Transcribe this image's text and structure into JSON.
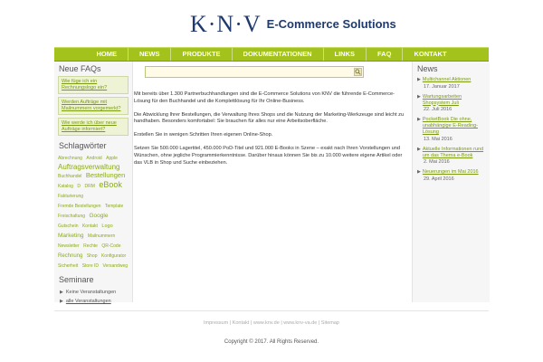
{
  "header": {
    "logo_mark": "K·N·V",
    "logo_text": "E-Commerce Solutions"
  },
  "nav": [
    "HOME",
    "NEWS",
    "PRODUKTE",
    "DOKUMENTATIONEN",
    "LINKS",
    "FAQ",
    "KONTAKT"
  ],
  "sidebar_left": {
    "faq_title": "Neue FAQs",
    "faqs": [
      "Wie füge ich ein Rechnungslogo ein?",
      "Werden Aufträge mit Mailnummern vorgemerkt?",
      "Wie werde ich über neue Aufträge informiert?"
    ],
    "tags_title": "Schlagwörter",
    "tags": [
      {
        "label": "Abrechnung",
        "size": 5
      },
      {
        "label": "Android",
        "size": 5
      },
      {
        "label": "Apple",
        "size": 5
      },
      {
        "label": "Auftragsverwaltung",
        "size": 8
      },
      {
        "label": "Buchhandel",
        "size": 5
      },
      {
        "label": "Bestellungen",
        "size": 7.5
      },
      {
        "label": "Katalog",
        "size": 5
      },
      {
        "label": "D",
        "size": 5
      },
      {
        "label": "DRM",
        "size": 5
      },
      {
        "label": "eBook",
        "size": 9
      },
      {
        "label": "Fakturierung",
        "size": 5
      },
      {
        "label": "Fremde Bestellungen",
        "size": 5
      },
      {
        "label": "Template",
        "size": 5
      },
      {
        "label": "Freischaltung",
        "size": 5
      },
      {
        "label": "Google",
        "size": 6.5
      },
      {
        "label": "Gutschein",
        "size": 5
      },
      {
        "label": "Kontakt",
        "size": 5
      },
      {
        "label": "Logo",
        "size": 5.5
      },
      {
        "label": "Marketing",
        "size": 6.5
      },
      {
        "label": "Mailnummern",
        "size": 5
      },
      {
        "label": "Newsletter",
        "size": 5
      },
      {
        "label": "Rechte",
        "size": 5
      },
      {
        "label": "QR-Code",
        "size": 5
      },
      {
        "label": "Rechnung",
        "size": 6
      },
      {
        "label": "Shop",
        "size": 5
      },
      {
        "label": "Konfigurator",
        "size": 5
      },
      {
        "label": "Sicherheit",
        "size": 5
      },
      {
        "label": "Store ID",
        "size": 5
      },
      {
        "label": "Versandweg",
        "size": 5
      }
    ],
    "seminar_title": "Seminare",
    "seminars": [
      {
        "label": "Keine Veranstaltungen",
        "linked": false
      },
      {
        "label": "alle Veranstaltungen",
        "linked": true
      }
    ]
  },
  "main": {
    "search": {
      "value": "",
      "placeholder": ""
    },
    "paragraphs": [
      "Mit bereits über 1.300 Partnerbuchhandlungen sind die E-Commerce Solutions von KNV die führende E-Commerce-Lösung für den Buchhandel und die Komplettlösung für Ihr Online-Business.",
      "Die Abwicklung Ihrer Bestellungen, die Verwaltung Ihres Shops und die Nutzung der Marketing-Werkzeuge sind leicht zu handhaben. Besonders komfortabel: Sie brauchen für alles nur eine Arbeitsoberfläche.",
      "Erstellen Sie in wenigen Schritten Ihren eigenen Online-Shop.",
      "Setzen Sie 500.000 Lagertitel, 450.000 PoD-Titel und 921.000 E-Books in Szene – exakt nach Ihren Vorstellungen und Wünschen, ohne jegliche Programmierkenntnisse. Darüber hinaus können Sie bis zu 10.000 weitere eigene Artikel oder das VLB in Shop und Suche einbeziehen."
    ]
  },
  "sidebar_right": {
    "title": "News",
    "items": [
      {
        "title": "Multichannel Aktionen",
        "date": "17. Januar 2017"
      },
      {
        "title": "Wartungsarbeiten Shopsystem Juli",
        "date": "22. Juli 2016"
      },
      {
        "title": "PocketBook Die ohne, unabhängige E-Reading-Lösung",
        "date": "13. Mai 2016"
      },
      {
        "title": "Aktuelle Informationen rund um das Thema e-Book",
        "date": "2. Mai 2016"
      },
      {
        "title": "Neuerungen im Mai 2016",
        "date": "29. April 2016"
      }
    ]
  },
  "footer": {
    "links": [
      "Impressum",
      "Kontakt",
      "www.knv.de",
      "www.knv-va.de",
      "Sitemap"
    ],
    "copyright": "Copyright © 2017. All Rights Reserved."
  },
  "colors": {
    "accent": "#a3c21c",
    "link": "#7a9a10",
    "brand": "#1f3a6b"
  }
}
